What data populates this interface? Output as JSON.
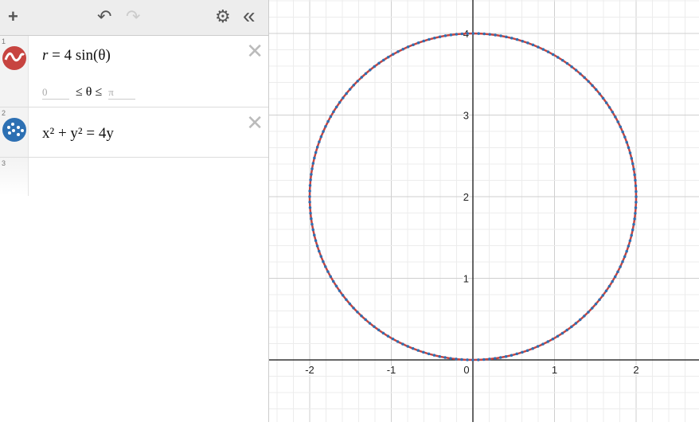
{
  "toolbar": {
    "add": "+",
    "undo": "↶",
    "redo": "↷",
    "settings": "⚙",
    "collapse": "«"
  },
  "expressions": [
    {
      "index": "1",
      "color": "#c74440",
      "r": "r",
      "eq": "=",
      "rhs": "4 sin(θ)",
      "domain_min": "0",
      "domain_var": "≤ θ ≤",
      "domain_max": "π",
      "delete": "✕"
    },
    {
      "index": "2",
      "color": "#2d70b3",
      "latex": "x² + y² = 4y",
      "delete": "✕"
    },
    {
      "index": "3"
    }
  ],
  "graph": {
    "x_ticks": [
      "-2",
      "-1",
      "0",
      "1",
      "2"
    ],
    "y_ticks": [
      "1",
      "2",
      "3",
      "4"
    ],
    "colors": {
      "curve1": "#c74440",
      "curve2": "#2d70b3"
    }
  }
}
